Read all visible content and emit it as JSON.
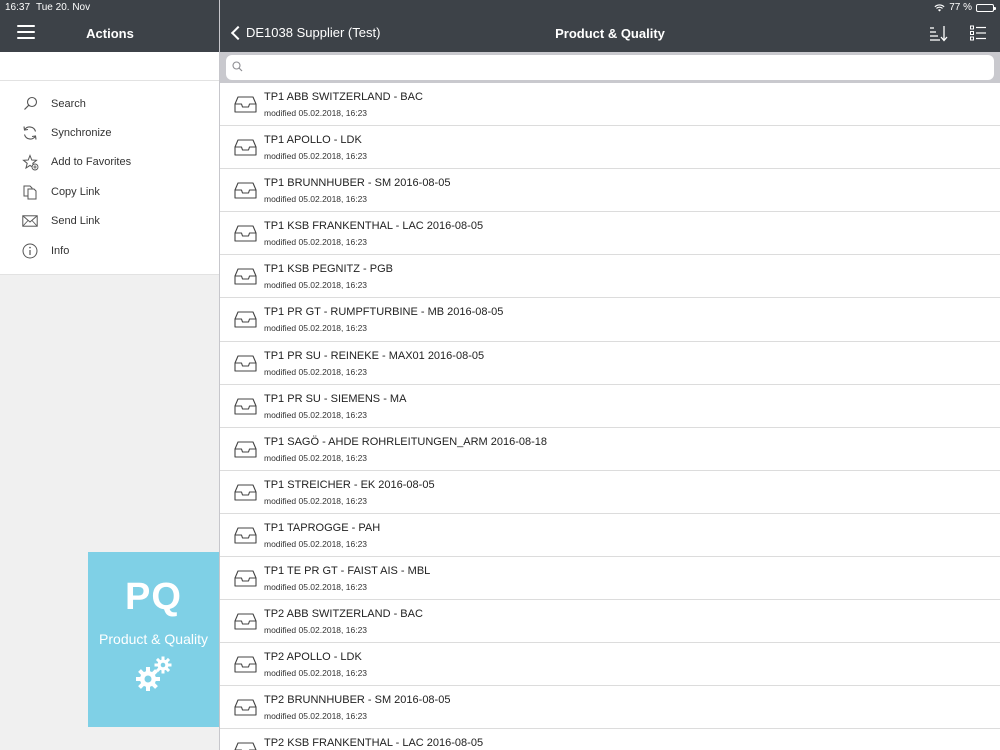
{
  "status": {
    "time": "16:37",
    "date": "Tue 20. Nov",
    "battery": "77 %",
    "battery_level": 0.77
  },
  "sidebar": {
    "title": "Actions",
    "items": [
      {
        "label": "Search",
        "icon": "search-icon"
      },
      {
        "label": "Synchronize",
        "icon": "sync-icon"
      },
      {
        "label": "Add to Favorites",
        "icon": "star-add-icon"
      },
      {
        "label": "Copy Link",
        "icon": "copy-icon"
      },
      {
        "label": "Send Link",
        "icon": "envelope-icon"
      },
      {
        "label": "Info",
        "icon": "info-icon"
      }
    ],
    "tile": {
      "abbr": "PQ",
      "name": "Product & Quality",
      "color": "#7fd0e6"
    }
  },
  "header": {
    "back_label": "DE1038 Supplier (Test)",
    "title": "Product & Quality"
  },
  "search": {
    "value": "",
    "placeholder": ""
  },
  "list": [
    {
      "title": "TP1 ABB SWITZERLAND - BAC",
      "modified": "modified 05.02.2018, 16:23"
    },
    {
      "title": "TP1 APOLLO - LDK",
      "modified": "modified 05.02.2018, 16:23"
    },
    {
      "title": "TP1 BRUNNHUBER - SM 2016-08-05",
      "modified": "modified 05.02.2018, 16:23"
    },
    {
      "title": "TP1 KSB FRANKENTHAL - LAC 2016-08-05",
      "modified": "modified 05.02.2018, 16:23"
    },
    {
      "title": "TP1 KSB PEGNITZ - PGB",
      "modified": "modified 05.02.2018, 16:23"
    },
    {
      "title": "TP1 PR GT - RUMPFTURBINE - MB 2016-08-05",
      "modified": "modified 05.02.2018, 16:23"
    },
    {
      "title": "TP1 PR SU - REINEKE - MAX01 2016-08-05",
      "modified": "modified 05.02.2018, 16:23"
    },
    {
      "title": "TP1 PR SU - SIEMENS - MA",
      "modified": "modified 05.02.2018, 16:23"
    },
    {
      "title": "TP1 SAGÖ - AHDE ROHRLEITUNGEN_ARM 2016-08-18",
      "modified": "modified 05.02.2018, 16:23"
    },
    {
      "title": "TP1 STREICHER - EK 2016-08-05",
      "modified": "modified 05.02.2018, 16:23"
    },
    {
      "title": "TP1 TAPROGGE - PAH",
      "modified": "modified 05.02.2018, 16:23"
    },
    {
      "title": "TP1 TE PR GT - FAIST AIS - MBL",
      "modified": "modified 05.02.2018, 16:23"
    },
    {
      "title": "TP2 ABB SWITZERLAND - BAC",
      "modified": "modified 05.02.2018, 16:23"
    },
    {
      "title": "TP2 APOLLO - LDK",
      "modified": "modified 05.02.2018, 16:23"
    },
    {
      "title": "TP2 BRUNNHUBER - SM 2016-08-05",
      "modified": "modified 05.02.2018, 16:23"
    },
    {
      "title": "TP2 KSB FRANKENTHAL - LAC 2016-08-05",
      "modified": ""
    }
  ]
}
